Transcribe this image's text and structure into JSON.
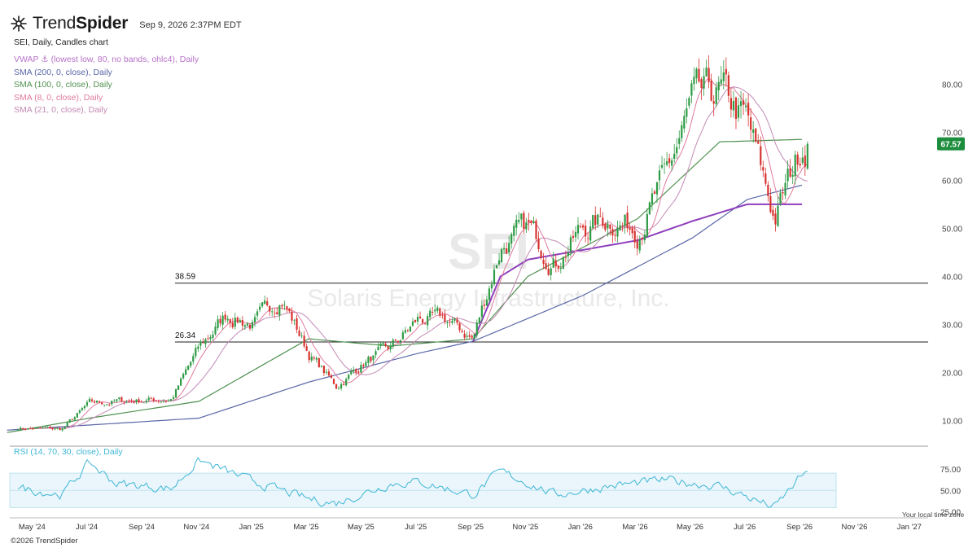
{
  "header": {
    "brand_light": "Trend",
    "brand_bold": "Spider",
    "timestamp": "Sep 9, 2026 2:37PM EDT"
  },
  "chart_title": "SEI, Daily, Candles chart",
  "indicators": [
    {
      "label": "VWAP ⚓ (lowest low, 80, no bands, ohlc4), Daily",
      "color": "#b772c9"
    },
    {
      "label": "SMA (200, 0, close), Daily",
      "color": "#5a67a8"
    },
    {
      "label": "SMA (100, 0, close), Daily",
      "color": "#4f9150"
    },
    {
      "label": "SMA (8, 0, close), Daily",
      "color": "#e07a9e"
    },
    {
      "label": "SMA (21, 0, close), Daily",
      "color": "#c38ab5"
    }
  ],
  "watermark": {
    "ticker": "SEI",
    "company": "Solaris Energy Infrastructure, Inc."
  },
  "rsi_label": "RSI (14, 70, 30, close), Daily",
  "copyright": "©2026 TrendSpider",
  "tz_note": "Your local time zone",
  "colors": {
    "up": "#2e9b45",
    "down": "#d8322f",
    "vwap": "#8f3fbd",
    "sma200": "#5a67a8",
    "sma100": "#4f9150",
    "sma8": "#e07a9e",
    "sma21": "#c38ab5",
    "rsi": "#3fb6d6",
    "price_badge": "#1e8e3e"
  },
  "chart_data": {
    "type": "line",
    "title": "SEI, Daily, Candles chart",
    "x_ticks": [
      "May '24",
      "Jul '24",
      "Sep '24",
      "Nov '24",
      "Jan '25",
      "Mar '25",
      "May '25",
      "Jul '25",
      "Sep '25",
      "Nov '25",
      "Jan '26",
      "Mar '26",
      "May '26",
      "Jul '26",
      "Sep '26",
      "Nov '26",
      "Jan '27"
    ],
    "y_ticks": [
      "10.00",
      "20.00",
      "30.00",
      "40.00",
      "50.00",
      "60.00",
      "70.00",
      "80.00"
    ],
    "ylim": [
      5,
      87
    ],
    "last_price": "67.57",
    "horizontal_levels": [
      {
        "value": 38.59,
        "label": "38.59"
      },
      {
        "value": 26.34,
        "label": "26.34"
      }
    ],
    "price_series": {
      "x": [
        "Apr '24",
        "Jun '24",
        "Jul '24",
        "Aug '24",
        "Oct '24",
        "Nov '24",
        "Dec '24",
        "Jan '25",
        "Feb '25",
        "Mar '25",
        "Apr '25",
        "May '25",
        "Jun '25",
        "Jul '25",
        "Aug '25",
        "Sep '25",
        "Oct '25",
        "Nov '25",
        "Dec '25",
        "Jan '26",
        "Feb '26",
        "Mar '26",
        "Apr '26",
        "May '26",
        "Jun '26",
        "Jul '26",
        "Aug '26",
        "Sep '26"
      ],
      "y": [
        8.5,
        8.2,
        13.5,
        14.0,
        14.5,
        25.0,
        32.0,
        30.0,
        36.0,
        24.0,
        17.0,
        22.0,
        25.0,
        31.0,
        31.0,
        27.0,
        46.0,
        50.0,
        43.0,
        50.0,
        52.0,
        50.0,
        60.0,
        76.0,
        78.0,
        72.0,
        52.0,
        67.6
      ]
    },
    "sma200": {
      "x": [
        "Apr '24",
        "Nov '24",
        "Mar '25",
        "Jul '25",
        "Sep '25",
        "Jan '26",
        "May '26",
        "Jul '26",
        "Sep '26"
      ],
      "y": [
        8.0,
        10.5,
        18.0,
        24.0,
        26.5,
        36.0,
        48.0,
        56.0,
        59.0
      ]
    },
    "sma100": {
      "x": [
        "Apr '24",
        "Jul '24",
        "Nov '24",
        "Mar '25",
        "Jun '25",
        "Sep '25",
        "Nov '25",
        "Mar '26",
        "Jun '26",
        "Sep '26"
      ],
      "y": [
        7.5,
        10.5,
        14.0,
        27.0,
        25.5,
        27.0,
        40.0,
        52.0,
        68.0,
        68.5
      ]
    },
    "vwap": {
      "x": [
        "Sep '25",
        "Oct '25",
        "Nov '25",
        "Jan '26",
        "Mar '26",
        "May '26",
        "Jul '26",
        "Sep '26"
      ],
      "y": [
        26.5,
        40.0,
        43.5,
        45.5,
        47.5,
        51.5,
        55.0,
        55.0
      ]
    },
    "rsi": {
      "y_ticks": [
        "25.00",
        "50.00",
        "75.00"
      ],
      "ylim": [
        20,
        90
      ],
      "bands": [
        30,
        70
      ],
      "x": [
        "Apr '24",
        "Jun '24",
        "Jul '24",
        "Aug '24",
        "Oct '24",
        "Nov '24",
        "Jan '25",
        "Mar '25",
        "Apr '25",
        "Jun '25",
        "Jul '25",
        "Sep '25",
        "Oct '25",
        "Dec '25",
        "Feb '26",
        "Apr '26",
        "Jun '26",
        "Aug '26",
        "Sep '26"
      ],
      "y": [
        55,
        45,
        82,
        58,
        52,
        85,
        60,
        40,
        35,
        58,
        60,
        45,
        72,
        45,
        55,
        62,
        55,
        30,
        68
      ]
    }
  }
}
